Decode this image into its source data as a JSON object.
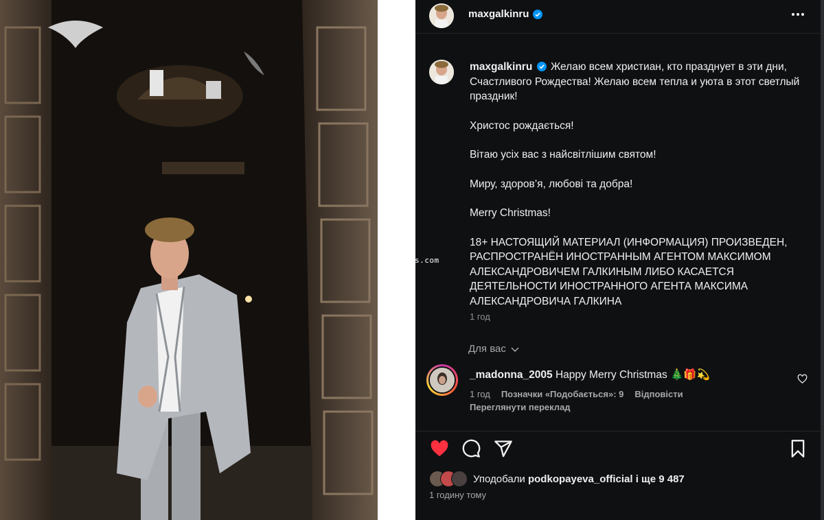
{
  "colors": {
    "panel_bg": "#0f1012",
    "text_primary": "#f0f0f0",
    "text_secondary": "#a8a8a8",
    "verified_blue": "#0095f6",
    "like_red": "#ff3040"
  },
  "photo": {
    "alt": ""
  },
  "watermark": "s.com",
  "post": {
    "header": {
      "username": "maxgalkinru",
      "verified_icon": "verified-badge-icon",
      "more_icon": "more-options-icon"
    },
    "caption": {
      "username": "maxgalkinru",
      "first_paragraph": "Желаю всем христиан, кто празднует в эти дни, Счастливого Рождества! Желаю всем тепла и уюта в этот светлый праздник!",
      "p2": "Христос рождається!",
      "p3": "Вітаю усіх вас з найсвітлішим святом!",
      "p4": "Миру, здоров’я, любові та добра!",
      "p5": "Merry Christmas!",
      "p6": "18+ НАСТОЯЩИЙ МАТЕРИАЛ (ИНФОРМАЦИЯ) ПРОИЗВЕДЕН, РАСПРОСТРАНЁН ИНОСТРАННЫМ АГЕНТОМ МАКСИМОМ АЛЕКСАНДРОВИЧЕМ ГАЛКИНЫМ ЛИБО КАСАЕТСЯ ДЕЯТЕЛЬНОСТИ ИНОСТРАННОГО АГЕНТА МАКСИМА АЛЕКСАНДРОВИЧА ГАЛКИНА",
      "time": "1 год"
    },
    "comments_filter": {
      "label": "Для вас",
      "icon": "chevron-down-icon"
    },
    "comment": {
      "username": "_madonna_2005",
      "text": "Happy Merry Christmas 🎄🎁💫",
      "time": "1 год",
      "likes": "Позначки «Подобається»: 9",
      "reply": "Відповісти",
      "translate": "Переглянути переклад"
    },
    "actions": {
      "like_icon": "heart-filled-icon",
      "comment_icon": "comment-icon",
      "share_icon": "share-icon",
      "save_icon": "bookmark-icon"
    },
    "likes": {
      "prefix": "Уподобали",
      "user": "podkopayeva_official",
      "suffix": "і ще 9 487"
    },
    "posted": "1 годину тому"
  }
}
